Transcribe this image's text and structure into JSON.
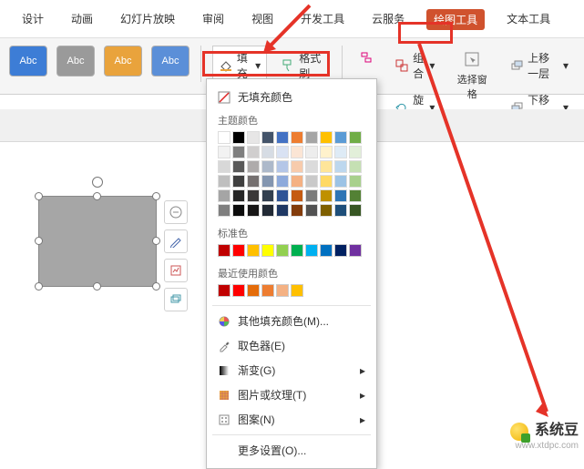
{
  "tabs": {
    "design": "设计",
    "anim": "动画",
    "slideshow": "幻灯片放映",
    "review": "审阅",
    "view": "视图",
    "dev": "开发工具",
    "cloud": "云服务",
    "draw": "绘图工具",
    "text": "文本工具"
  },
  "style_label": "Abc",
  "ribbon": {
    "fill": "填充",
    "format_painter": "格式刷",
    "group": "组合",
    "rotate": "旋转",
    "select_pane": "选择窗格",
    "move_up": "上移一层",
    "move_down": "下移一层"
  },
  "dd": {
    "no_fill": "无填充颜色",
    "theme_label": "主题颜色",
    "std_label": "标准色",
    "recent_label": "最近使用颜色",
    "more_colors": "其他填充颜色(M)...",
    "eyedropper": "取色器(E)",
    "gradient": "渐变(G)",
    "texture": "图片或纹理(T)",
    "pattern": "图案(N)",
    "more_settings": "更多设置(O)...",
    "theme_base": [
      "#ffffff",
      "#000000",
      "#e7e6e6",
      "#44546a",
      "#4472c4",
      "#ed7d31",
      "#a5a5a5",
      "#ffc000",
      "#5b9bd5",
      "#70ad47"
    ],
    "theme_tints": [
      [
        "#f2f2f2",
        "#7f7f7f",
        "#d0cece",
        "#d6dce4",
        "#d9e2f3",
        "#fbe5d5",
        "#ededed",
        "#fff2cc",
        "#deebf6",
        "#e2efd9"
      ],
      [
        "#d8d8d8",
        "#595959",
        "#aeabab",
        "#adb9ca",
        "#b4c6e7",
        "#f7cbac",
        "#dbdbdb",
        "#fee599",
        "#bdd7ee",
        "#c5e0b3"
      ],
      [
        "#bfbfbf",
        "#3f3f3f",
        "#757070",
        "#8496b0",
        "#8eaadb",
        "#f4b183",
        "#c9c9c9",
        "#ffd965",
        "#9cc3e5",
        "#a8d08d"
      ],
      [
        "#a5a5a5",
        "#262626",
        "#3a3838",
        "#323f4f",
        "#2f5496",
        "#c55a11",
        "#7b7b7b",
        "#bf9000",
        "#2e75b5",
        "#538135"
      ],
      [
        "#7f7f7f",
        "#0c0c0c",
        "#171616",
        "#222a35",
        "#1f3864",
        "#833c0b",
        "#525252",
        "#7f6000",
        "#1e4e79",
        "#375623"
      ]
    ],
    "standard": [
      "#c00000",
      "#ff0000",
      "#ffc000",
      "#ffff00",
      "#92d050",
      "#00b050",
      "#00b0f0",
      "#0070c0",
      "#002060",
      "#7030a0"
    ],
    "recent": [
      "#c00000",
      "#ff0000",
      "#e46c0a",
      "#ed7d31",
      "#f4b183",
      "#ffc000"
    ]
  },
  "watermark": "系统豆",
  "watermark_url": "www.xtdpc.com"
}
